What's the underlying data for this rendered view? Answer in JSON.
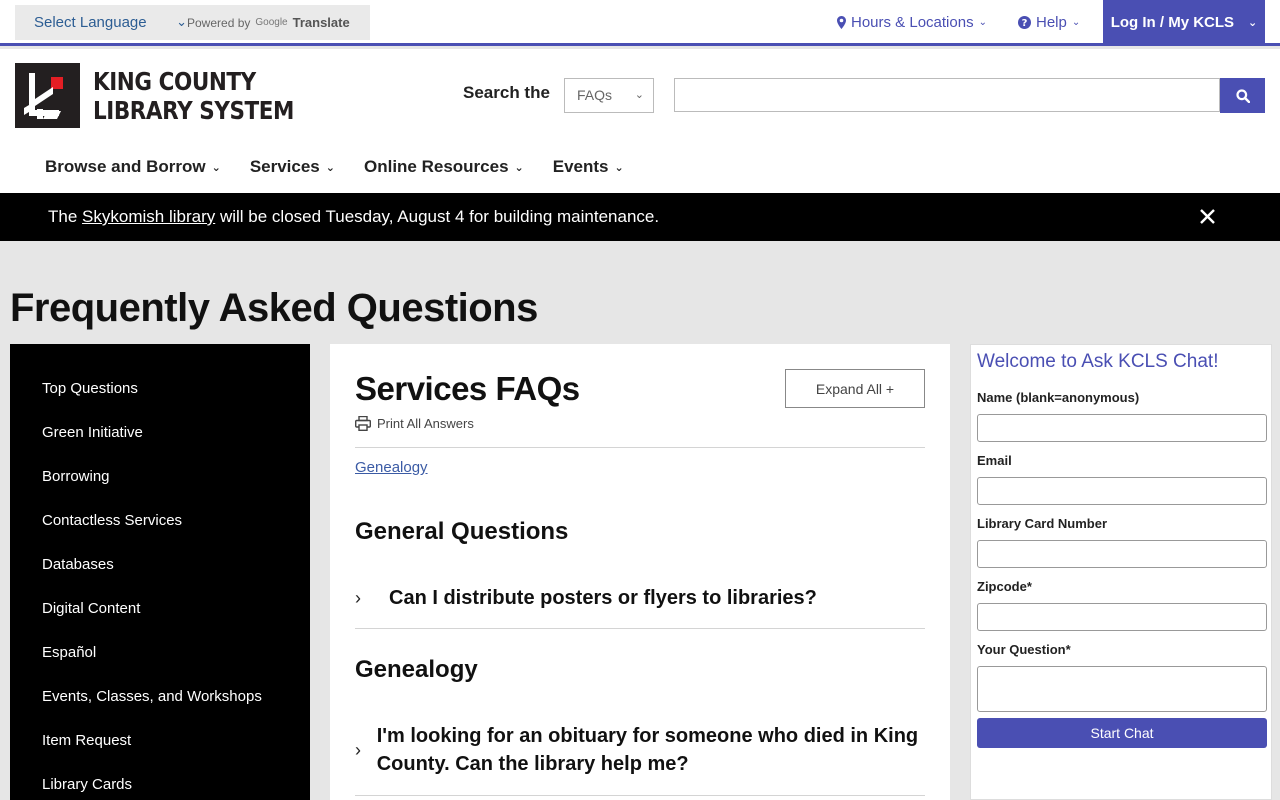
{
  "utility": {
    "language_select": "Select Language",
    "powered_by": "Powered by",
    "google": "Google",
    "translate": "Translate",
    "hours_locations": "Hours & Locations",
    "help": "Help",
    "login": "Log In / My KCLS"
  },
  "header": {
    "logo_line1": "KING COUNTY",
    "logo_line2": "LIBRARY SYSTEM",
    "search_label": "Search the",
    "search_scope": "FAQs",
    "search_value": ""
  },
  "nav": [
    {
      "label": "Browse and Borrow"
    },
    {
      "label": "Services"
    },
    {
      "label": "Online Resources"
    },
    {
      "label": "Events"
    }
  ],
  "alert": {
    "prefix": "The",
    "link": "Skykomish library",
    "suffix": "will be closed Tuesday, August 4 for building maintenance."
  },
  "page": {
    "title": "Frequently Asked Questions"
  },
  "sidebar": {
    "items": [
      {
        "label": "Top Questions"
      },
      {
        "label": "Green Initiative"
      },
      {
        "label": "Borrowing"
      },
      {
        "label": "Contactless Services"
      },
      {
        "label": "Databases"
      },
      {
        "label": "Digital Content"
      },
      {
        "label": "Español"
      },
      {
        "label": "Events, Classes, and Workshops"
      },
      {
        "label": "Item Request"
      },
      {
        "label": "Library Cards"
      }
    ]
  },
  "content": {
    "title": "Services FAQs",
    "expand_all": "Expand All +",
    "print_all": "Print All Answers",
    "jump_link": "Genealogy",
    "sections": [
      {
        "heading": "General Questions",
        "questions": [
          "Can I distribute posters or flyers to libraries?"
        ]
      },
      {
        "heading": "Genealogy",
        "questions": [
          "I'm looking for an obituary for someone who died in King County. Can the library help me?"
        ]
      }
    ]
  },
  "chat": {
    "title": "Welcome to Ask KCLS Chat!",
    "name_label": "Name (blank=anonymous)",
    "email_label": "Email",
    "card_label": "Library Card Number",
    "zip_label": "Zipcode*",
    "question_label": "Your Question*",
    "start_button": "Start Chat"
  },
  "colors": {
    "accent": "#4a4fb3",
    "alert_bg": "#000000",
    "page_bg": "#e6e6e6"
  }
}
